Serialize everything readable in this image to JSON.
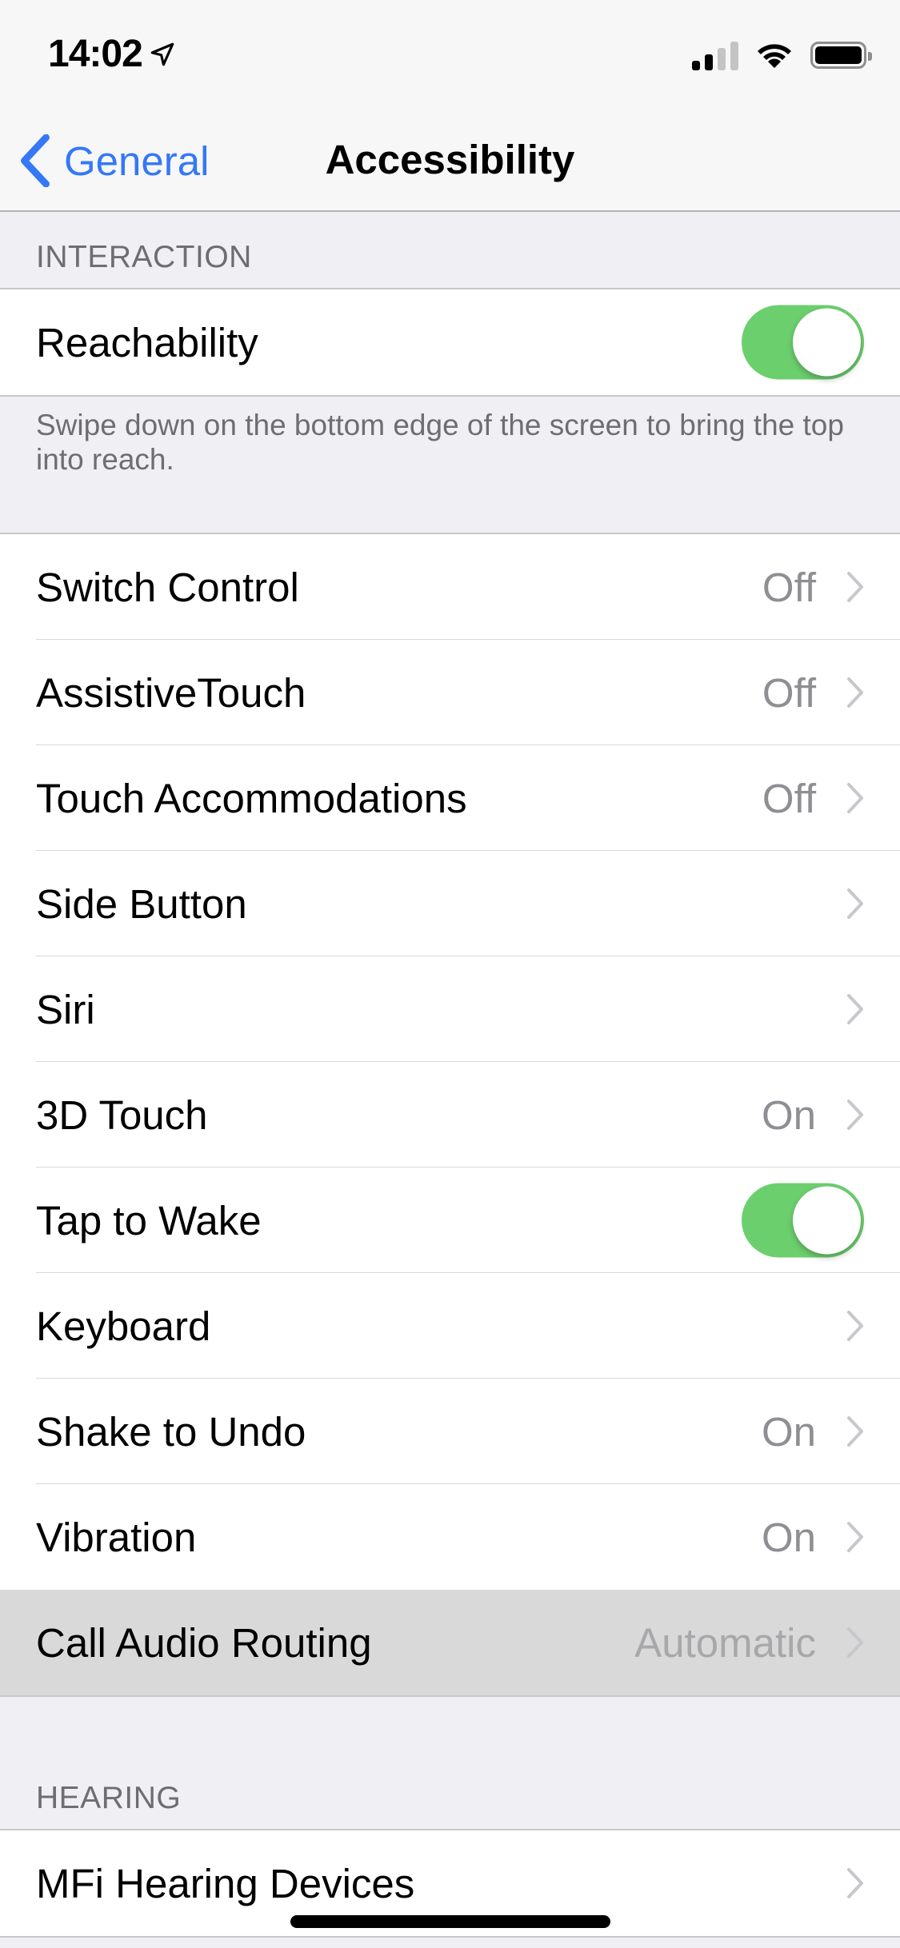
{
  "status_bar": {
    "time": "14:02",
    "location_icon": "location-arrow-icon",
    "signal_bars": 2,
    "signal_max": 4,
    "wifi_icon": "wifi-icon",
    "battery_level": 0.95
  },
  "nav": {
    "back_label": "General",
    "title": "Accessibility"
  },
  "colors": {
    "accent": "#3478f6",
    "toggle_on": "#6ccf6e",
    "background": "#efeff4",
    "secondary_text": "#8e8e93"
  },
  "interaction": {
    "header": "INTERACTION",
    "reachability": {
      "label": "Reachability",
      "enabled": true
    },
    "reachability_footer": "Swipe down on the bottom edge of the screen to bring the top into reach.",
    "rows": [
      {
        "label": "Switch Control",
        "value": "Off"
      },
      {
        "label": "AssistiveTouch",
        "value": "Off"
      },
      {
        "label": "Touch Accommodations",
        "value": "Off"
      },
      {
        "label": "Side Button",
        "value": ""
      },
      {
        "label": "Siri",
        "value": ""
      },
      {
        "label": "3D Touch",
        "value": "On"
      },
      {
        "label": "Tap to Wake",
        "toggle": true,
        "enabled": true
      },
      {
        "label": "Keyboard",
        "value": ""
      },
      {
        "label": "Shake to Undo",
        "value": "On"
      },
      {
        "label": "Vibration",
        "value": "On"
      },
      {
        "label": "Call Audio Routing",
        "value": "Automatic",
        "highlighted": true
      }
    ]
  },
  "hearing": {
    "header": "HEARING",
    "rows": [
      {
        "label": "MFi Hearing Devices",
        "value": ""
      }
    ]
  }
}
